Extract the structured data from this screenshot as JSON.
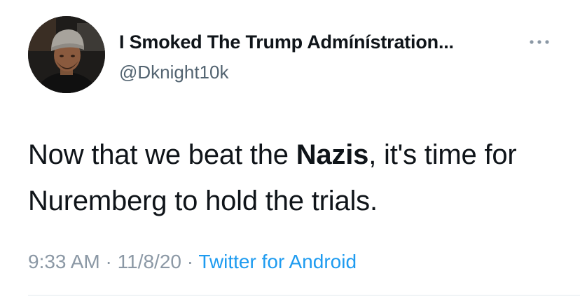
{
  "author": {
    "display_name": "I Smoked The Trump Admínístration...",
    "handle": "@Dknight10k",
    "avatar_icon": "user-avatar-photo"
  },
  "more_icon": "ellipsis-icon",
  "tweet": {
    "text_before": "Now that we beat the ",
    "text_bold": "Nazis",
    "text_after": ", it's time for Nuremberg to hold the trials."
  },
  "meta": {
    "time": "9:33 AM",
    "separator": "·",
    "date": "11/8/20",
    "source": "Twitter for Android"
  },
  "colors": {
    "text": "#0f1419",
    "secondary": "#536471",
    "link": "#1d9bf0",
    "meta": "#8b98a5"
  }
}
